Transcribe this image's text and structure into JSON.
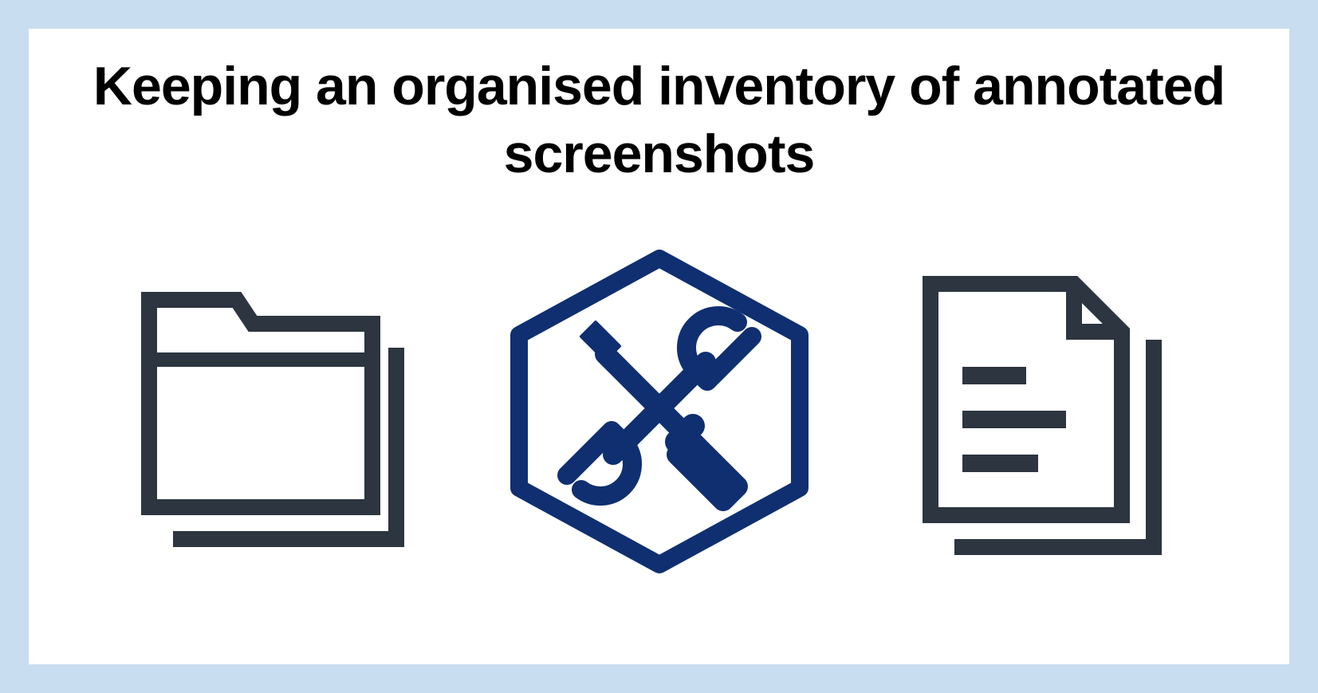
{
  "title": "Keeping an organised inventory of annotated screenshots",
  "colors": {
    "border": "#c9ddf0",
    "card": "#ffffff",
    "heading": "#000000",
    "iconDark": "#2c3540",
    "iconBlue": "#0f2f71"
  },
  "icons": [
    {
      "name": "folders-icon",
      "label": "Folders"
    },
    {
      "name": "tools-hexagon-icon",
      "label": "Tools"
    },
    {
      "name": "documents-icon",
      "label": "Documents"
    }
  ]
}
